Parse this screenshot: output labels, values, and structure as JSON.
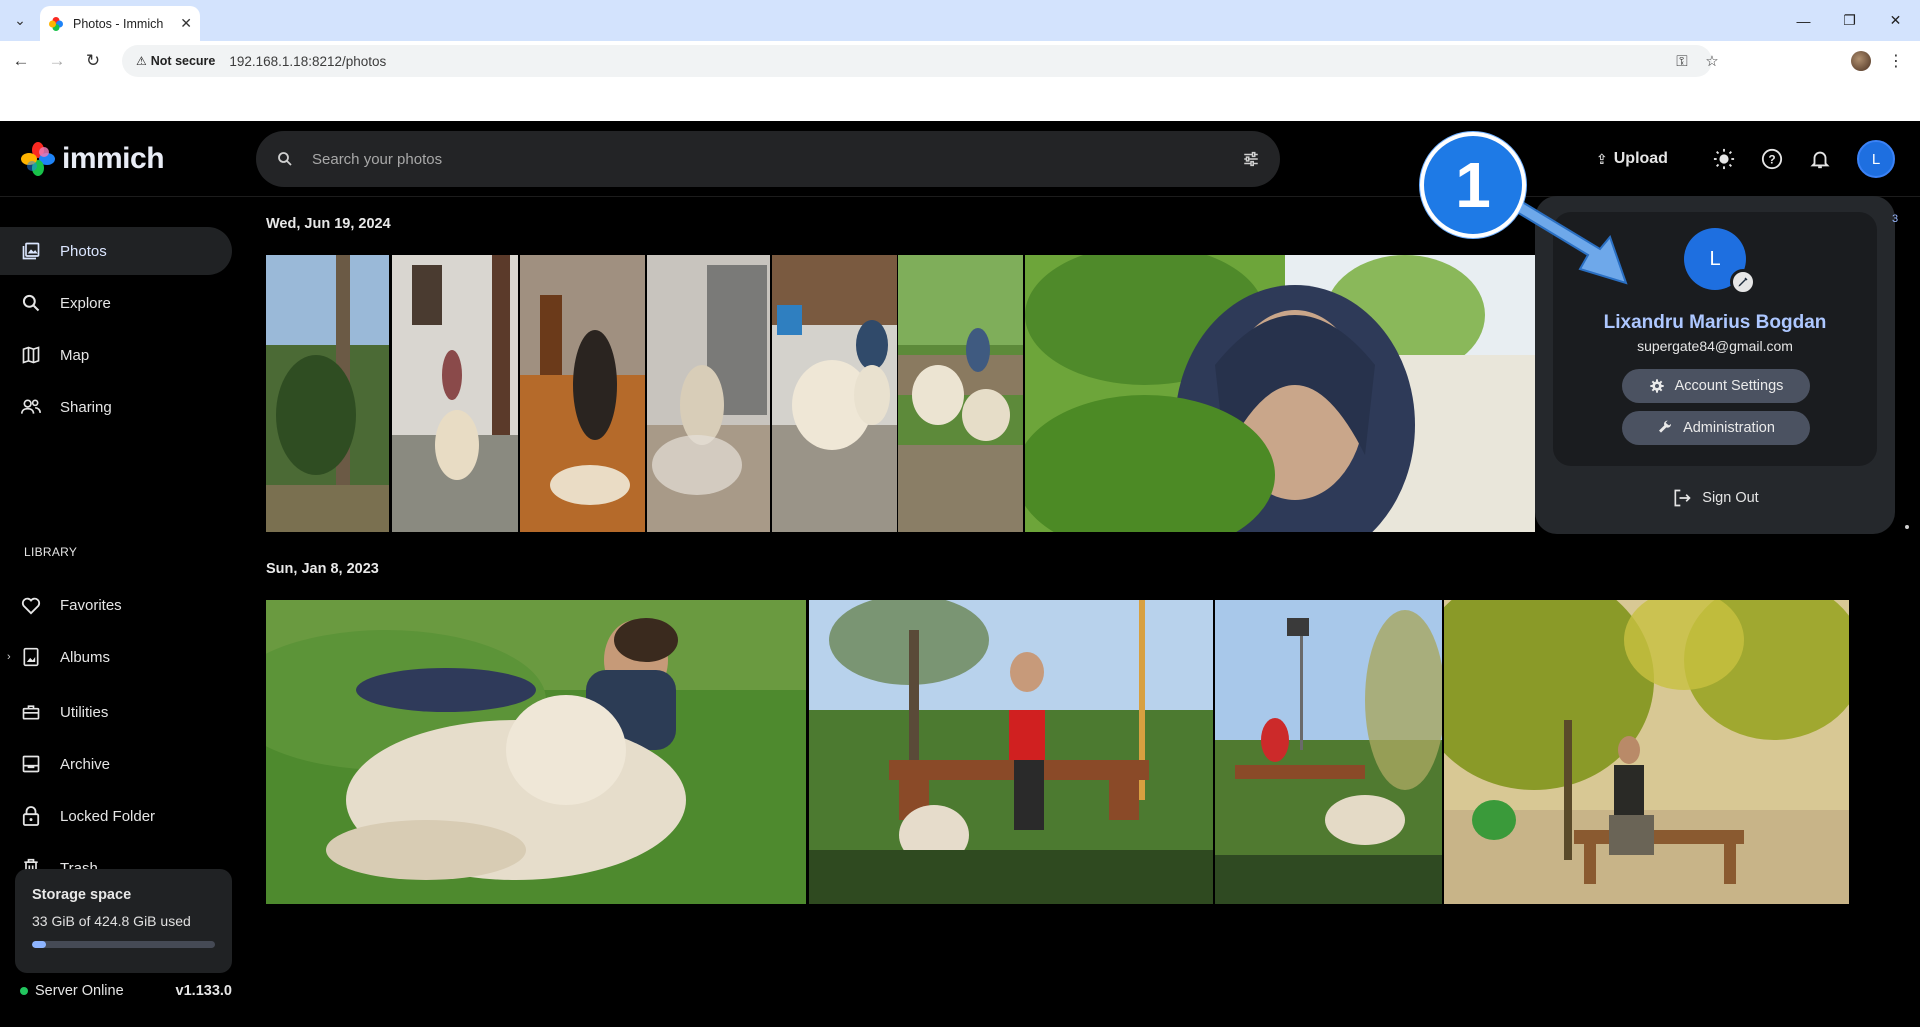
{
  "browser": {
    "tab_title": "Photos - Immich",
    "not_secure_label": "Not secure",
    "url": "192.168.1.18:8212/photos"
  },
  "app": {
    "logo_text": "immich",
    "search_placeholder": "Search your photos",
    "upload_label": "Upload",
    "avatar_initial": "L"
  },
  "callout": {
    "number": "1"
  },
  "sidebar": {
    "items": [
      {
        "label": "Photos",
        "icon": "photos-icon"
      },
      {
        "label": "Explore",
        "icon": "search-icon"
      },
      {
        "label": "Map",
        "icon": "map-icon"
      },
      {
        "label": "Sharing",
        "icon": "people-icon"
      }
    ],
    "library_heading": "LIBRARY",
    "library_items": [
      {
        "label": "Favorites",
        "icon": "heart-icon"
      },
      {
        "label": "Albums",
        "icon": "album-icon"
      },
      {
        "label": "Utilities",
        "icon": "utilities-icon"
      },
      {
        "label": "Archive",
        "icon": "archive-icon"
      },
      {
        "label": "Locked Folder",
        "icon": "lock-icon"
      },
      {
        "label": "Trash",
        "icon": "trash-icon"
      }
    ]
  },
  "storage": {
    "title": "Storage space",
    "used_text": "33 GiB of 424.8 GiB used",
    "used_fraction": 0.078
  },
  "server": {
    "status": "Server Online",
    "version": "v1.133.0"
  },
  "timeline": {
    "groups": [
      {
        "date": "Wed, Jun 19, 2024"
      },
      {
        "date": "Sun, Jan 8, 2023"
      }
    ]
  },
  "account_panel": {
    "initial": "L",
    "name": "Lixandru Marius Bogdan",
    "email": "supergate84@gmail.com",
    "account_settings_label": "Account Settings",
    "administration_label": "Administration",
    "sign_out_label": "Sign Out"
  },
  "scrubber": {
    "partial_label": "3"
  }
}
